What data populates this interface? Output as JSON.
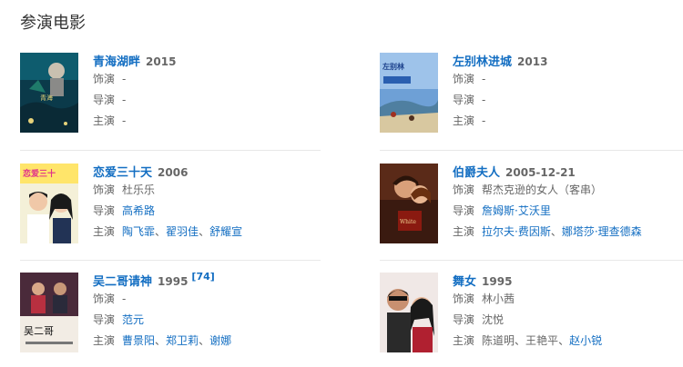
{
  "section_title": "参演电影",
  "films": [
    {
      "title": "青海湖畔",
      "year": "2015",
      "ref": "",
      "role_label": "饰演",
      "role": [
        {
          "t": "-",
          "link": false
        }
      ],
      "director_label": "导演",
      "director": [
        {
          "t": "-",
          "link": false
        }
      ],
      "cast_label": "主演",
      "cast": [
        {
          "t": "-",
          "link": false
        }
      ],
      "poster": "qinghai"
    },
    {
      "title": "左别林进城",
      "year": "2013",
      "ref": "",
      "role_label": "饰演",
      "role": [
        {
          "t": "-",
          "link": false
        }
      ],
      "director_label": "导演",
      "director": [
        {
          "t": "-",
          "link": false
        }
      ],
      "cast_label": "主演",
      "cast": [
        {
          "t": "-",
          "link": false
        }
      ],
      "poster": "zuobielin"
    },
    {
      "title": "恋爱三十天",
      "year": "2006",
      "ref": "",
      "role_label": "饰演",
      "role": [
        {
          "t": "杜乐乐",
          "link": false
        }
      ],
      "director_label": "导演",
      "director": [
        {
          "t": "高希路",
          "link": true
        }
      ],
      "cast_label": "主演",
      "cast": [
        {
          "t": "陶飞霏",
          "link": true
        },
        {
          "t": "、",
          "link": false
        },
        {
          "t": "翟羽佳",
          "link": true
        },
        {
          "t": "、",
          "link": false
        },
        {
          "t": "舒耀宣",
          "link": true
        }
      ],
      "poster": "lianai"
    },
    {
      "title": "伯爵夫人",
      "year": "2005-12-21",
      "ref": "",
      "role_label": "饰演",
      "role": [
        {
          "t": "帮杰克逊的女人（客串）",
          "link": false
        }
      ],
      "director_label": "导演",
      "director": [
        {
          "t": "詹姆斯·艾沃里",
          "link": true
        }
      ],
      "cast_label": "主演",
      "cast": [
        {
          "t": "拉尔夫·费因斯",
          "link": true
        },
        {
          "t": "、",
          "link": false
        },
        {
          "t": "娜塔莎·理查德森",
          "link": true
        }
      ],
      "poster": "bojue"
    },
    {
      "title": "吴二哥请神",
      "year": "1995",
      "ref": "[74]",
      "role_label": "饰演",
      "role": [
        {
          "t": "-",
          "link": false
        }
      ],
      "director_label": "导演",
      "director": [
        {
          "t": "范元",
          "link": true
        }
      ],
      "cast_label": "主演",
      "cast": [
        {
          "t": "曹景阳",
          "link": true
        },
        {
          "t": "、",
          "link": false
        },
        {
          "t": "郑卫莉",
          "link": true
        },
        {
          "t": "、",
          "link": false
        },
        {
          "t": "谢娜",
          "link": true
        }
      ],
      "poster": "wuerge"
    },
    {
      "title": "舞女",
      "year": "1995",
      "ref": "",
      "role_label": "饰演",
      "role": [
        {
          "t": "林小茜",
          "link": false
        }
      ],
      "director_label": "导演",
      "director": [
        {
          "t": "沈悦",
          "link": false
        }
      ],
      "cast_label": "主演",
      "cast": [
        {
          "t": "陈道明",
          "link": false
        },
        {
          "t": "、",
          "link": false
        },
        {
          "t": "王艳平",
          "link": false
        },
        {
          "t": "、",
          "link": false
        },
        {
          "t": "赵小锐",
          "link": true
        }
      ],
      "poster": "wunv"
    }
  ]
}
